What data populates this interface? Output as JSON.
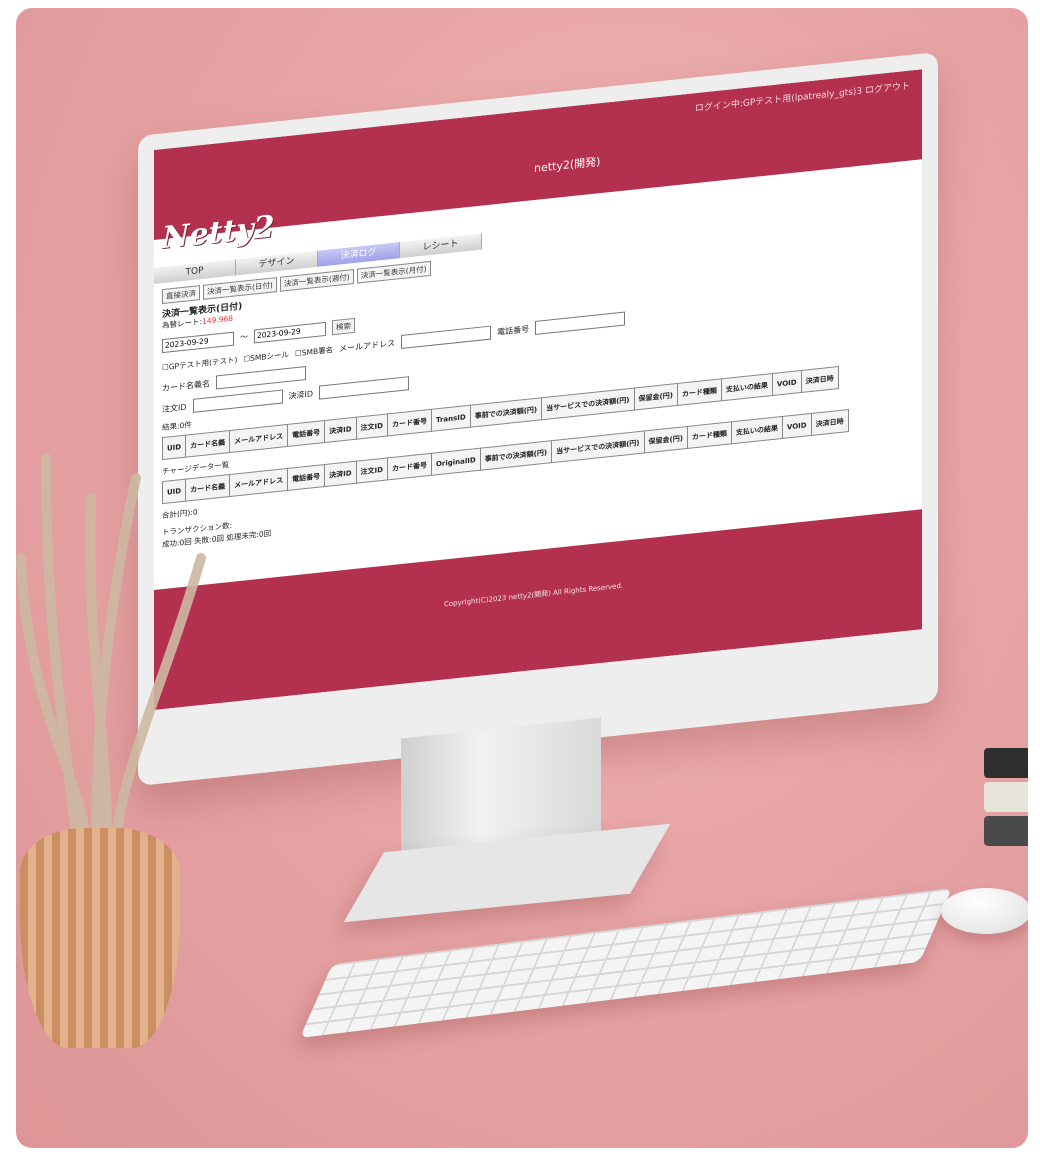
{
  "app": {
    "site_name": "netty2(開発)",
    "login_text": "ログイン中:GPテスト用(lpatrealy_gts)3 ログアウト",
    "logo": "Netty2"
  },
  "nav": {
    "items": [
      {
        "label": "TOP"
      },
      {
        "label": "デザイン"
      },
      {
        "label": "決済ログ"
      },
      {
        "label": "レシート"
      }
    ]
  },
  "toolbar": {
    "buttons": [
      {
        "label": "直接決済"
      },
      {
        "label": "決済一覧表示(日付)"
      },
      {
        "label": "決済一覧表示(週付)"
      },
      {
        "label": "決済一覧表示(月付)"
      }
    ]
  },
  "page": {
    "title": "決済一覧表示(日付)",
    "rate_label": "為替レート:",
    "rate_value": "149.968",
    "date_from": "2023-09-29",
    "range_sep": "〜",
    "date_to": "2023-09-29",
    "search_label": "検索",
    "gp_test_label": "GPテスト用(テスト)",
    "smb_seal_label": "SMBシール",
    "smb_sign_label": "SMB署名",
    "email_label": "メールアドレス",
    "phone_label": "電話番号",
    "card_name_label": "カード名義名",
    "order_id_label": "注文ID",
    "payment_id_label": "決済ID",
    "result_count": "結果:0件",
    "charge_section": "チャージデータ一覧",
    "total_label": "合計(円):0",
    "transaction_label": "トランザクション数:",
    "transaction_values": "成功:0回 失敗:0回 処理未完:0回"
  },
  "table1": {
    "headers": [
      "UID",
      "カード名義",
      "メールアドレス",
      "電話番号",
      "決済ID",
      "注文ID",
      "カード番号",
      "TransID",
      "事前での決済額(円)",
      "当サービスでの決済額(円)",
      "保留金(円)",
      "カード種類",
      "支払いの結果",
      "VOID",
      "決済日時"
    ]
  },
  "table2": {
    "headers": [
      "UID",
      "カード名義",
      "メールアドレス",
      "電話番号",
      "決済ID",
      "注文ID",
      "カード番号",
      "OriginalID",
      "事前での決済額(円)",
      "当サービスでの決済額(円)",
      "保留金(円)",
      "カード種類",
      "支払いの結果",
      "VOID",
      "決済日時"
    ]
  },
  "footer": {
    "copyright": "Copyright(C)2023 netty2(開発) All Rights Reserved."
  },
  "colors": {
    "brand": "#b3304e",
    "background": "#e8a5a6",
    "nav_active": "#9ea1e8"
  }
}
